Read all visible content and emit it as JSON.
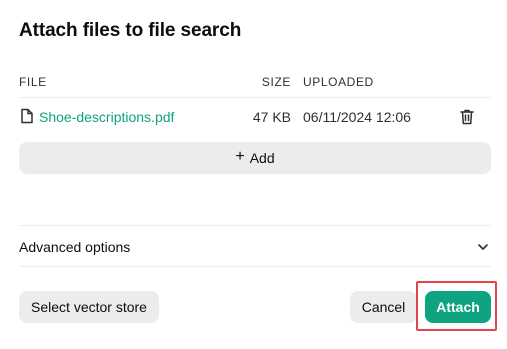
{
  "dialog": {
    "title": "Attach files to file search"
  },
  "table": {
    "headers": {
      "file": "FILE",
      "size": "SIZE",
      "uploaded": "UPLOADED"
    },
    "rows": [
      {
        "name": "Shoe-descriptions.pdf",
        "size": "47 KB",
        "uploaded": "06/11/2024 12:06",
        "icon": "file-icon",
        "action_icon": "trash-icon"
      }
    ]
  },
  "add_button": {
    "icon": "plus-icon",
    "label": "Add"
  },
  "advanced": {
    "label": "Advanced options",
    "icon": "chevron-down-icon"
  },
  "footer": {
    "select_store_label": "Select vector store",
    "cancel_label": "Cancel",
    "attach_label": "Attach"
  },
  "colors": {
    "accent": "#10a37f",
    "highlight": "#e0464b",
    "button_bg": "#ececec"
  }
}
